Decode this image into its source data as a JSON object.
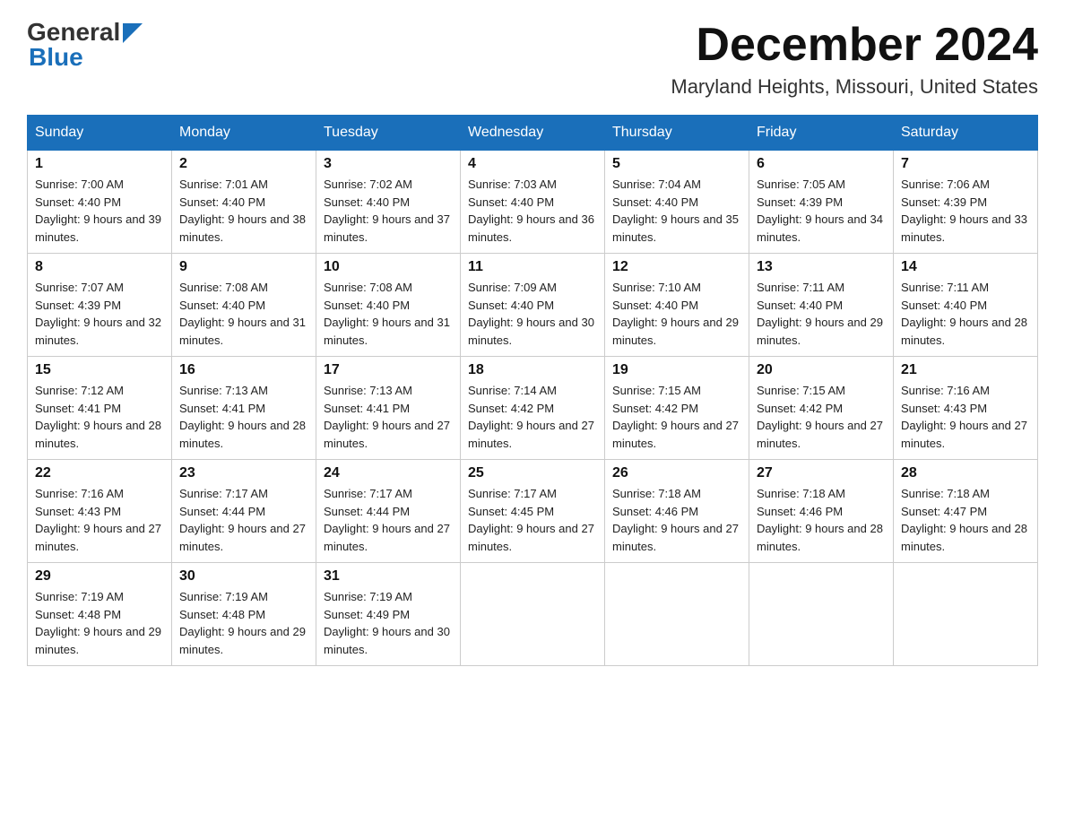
{
  "header": {
    "logo_general": "General",
    "logo_blue": "Blue",
    "month_title": "December 2024",
    "location": "Maryland Heights, Missouri, United States"
  },
  "weekdays": [
    "Sunday",
    "Monday",
    "Tuesday",
    "Wednesday",
    "Thursday",
    "Friday",
    "Saturday"
  ],
  "weeks": [
    [
      {
        "day": "1",
        "sunrise": "7:00 AM",
        "sunset": "4:40 PM",
        "daylight": "9 hours and 39 minutes."
      },
      {
        "day": "2",
        "sunrise": "7:01 AM",
        "sunset": "4:40 PM",
        "daylight": "9 hours and 38 minutes."
      },
      {
        "day": "3",
        "sunrise": "7:02 AM",
        "sunset": "4:40 PM",
        "daylight": "9 hours and 37 minutes."
      },
      {
        "day": "4",
        "sunrise": "7:03 AM",
        "sunset": "4:40 PM",
        "daylight": "9 hours and 36 minutes."
      },
      {
        "day": "5",
        "sunrise": "7:04 AM",
        "sunset": "4:40 PM",
        "daylight": "9 hours and 35 minutes."
      },
      {
        "day": "6",
        "sunrise": "7:05 AM",
        "sunset": "4:39 PM",
        "daylight": "9 hours and 34 minutes."
      },
      {
        "day": "7",
        "sunrise": "7:06 AM",
        "sunset": "4:39 PM",
        "daylight": "9 hours and 33 minutes."
      }
    ],
    [
      {
        "day": "8",
        "sunrise": "7:07 AM",
        "sunset": "4:39 PM",
        "daylight": "9 hours and 32 minutes."
      },
      {
        "day": "9",
        "sunrise": "7:08 AM",
        "sunset": "4:40 PM",
        "daylight": "9 hours and 31 minutes."
      },
      {
        "day": "10",
        "sunrise": "7:08 AM",
        "sunset": "4:40 PM",
        "daylight": "9 hours and 31 minutes."
      },
      {
        "day": "11",
        "sunrise": "7:09 AM",
        "sunset": "4:40 PM",
        "daylight": "9 hours and 30 minutes."
      },
      {
        "day": "12",
        "sunrise": "7:10 AM",
        "sunset": "4:40 PM",
        "daylight": "9 hours and 29 minutes."
      },
      {
        "day": "13",
        "sunrise": "7:11 AM",
        "sunset": "4:40 PM",
        "daylight": "9 hours and 29 minutes."
      },
      {
        "day": "14",
        "sunrise": "7:11 AM",
        "sunset": "4:40 PM",
        "daylight": "9 hours and 28 minutes."
      }
    ],
    [
      {
        "day": "15",
        "sunrise": "7:12 AM",
        "sunset": "4:41 PM",
        "daylight": "9 hours and 28 minutes."
      },
      {
        "day": "16",
        "sunrise": "7:13 AM",
        "sunset": "4:41 PM",
        "daylight": "9 hours and 28 minutes."
      },
      {
        "day": "17",
        "sunrise": "7:13 AM",
        "sunset": "4:41 PM",
        "daylight": "9 hours and 27 minutes."
      },
      {
        "day": "18",
        "sunrise": "7:14 AM",
        "sunset": "4:42 PM",
        "daylight": "9 hours and 27 minutes."
      },
      {
        "day": "19",
        "sunrise": "7:15 AM",
        "sunset": "4:42 PM",
        "daylight": "9 hours and 27 minutes."
      },
      {
        "day": "20",
        "sunrise": "7:15 AM",
        "sunset": "4:42 PM",
        "daylight": "9 hours and 27 minutes."
      },
      {
        "day": "21",
        "sunrise": "7:16 AM",
        "sunset": "4:43 PM",
        "daylight": "9 hours and 27 minutes."
      }
    ],
    [
      {
        "day": "22",
        "sunrise": "7:16 AM",
        "sunset": "4:43 PM",
        "daylight": "9 hours and 27 minutes."
      },
      {
        "day": "23",
        "sunrise": "7:17 AM",
        "sunset": "4:44 PM",
        "daylight": "9 hours and 27 minutes."
      },
      {
        "day": "24",
        "sunrise": "7:17 AM",
        "sunset": "4:44 PM",
        "daylight": "9 hours and 27 minutes."
      },
      {
        "day": "25",
        "sunrise": "7:17 AM",
        "sunset": "4:45 PM",
        "daylight": "9 hours and 27 minutes."
      },
      {
        "day": "26",
        "sunrise": "7:18 AM",
        "sunset": "4:46 PM",
        "daylight": "9 hours and 27 minutes."
      },
      {
        "day": "27",
        "sunrise": "7:18 AM",
        "sunset": "4:46 PM",
        "daylight": "9 hours and 28 minutes."
      },
      {
        "day": "28",
        "sunrise": "7:18 AM",
        "sunset": "4:47 PM",
        "daylight": "9 hours and 28 minutes."
      }
    ],
    [
      {
        "day": "29",
        "sunrise": "7:19 AM",
        "sunset": "4:48 PM",
        "daylight": "9 hours and 29 minutes."
      },
      {
        "day": "30",
        "sunrise": "7:19 AM",
        "sunset": "4:48 PM",
        "daylight": "9 hours and 29 minutes."
      },
      {
        "day": "31",
        "sunrise": "7:19 AM",
        "sunset": "4:49 PM",
        "daylight": "9 hours and 30 minutes."
      },
      null,
      null,
      null,
      null
    ]
  ],
  "labels": {
    "sunrise": "Sunrise: ",
    "sunset": "Sunset: ",
    "daylight": "Daylight: "
  }
}
